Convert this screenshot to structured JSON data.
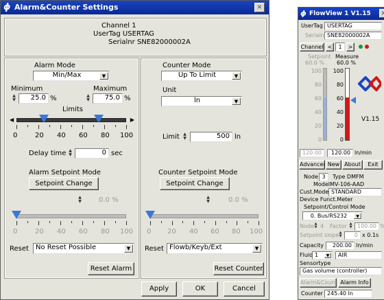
{
  "left": {
    "title": "Alarm&Counter Settings",
    "close": "×",
    "channel_label": "Channel",
    "channel_value": "1",
    "usertag_label": "UserTag",
    "usertag_value": "USERTAG",
    "serial_label": "Serialnr",
    "serial_value": "SNE82000002A",
    "alarm": {
      "mode_label": "Alarm Mode",
      "mode_value": "Min/Max",
      "min_label": "Minimum",
      "min_value": "25.0",
      "min_unit": "%",
      "max_label": "Maximum",
      "max_value": "75.0",
      "max_unit": "%",
      "limits_label": "Limits",
      "scale": [
        "0",
        "20",
        "40",
        "60",
        "80",
        "100"
      ],
      "min_fraction": 0.25,
      "max_fraction": 0.75,
      "delay_label": "Delay time",
      "delay_value": "0",
      "delay_unit": "sec",
      "sp_mode_label": "Alarm Setpoint Mode",
      "sp_button": "Setpoint Change",
      "sp_value": "0.0",
      "sp_unit": "%",
      "reset_label": "Reset",
      "reset_value": "No Reset Possible",
      "reset_button": "Reset Alarm"
    },
    "counter": {
      "mode_label": "Counter Mode",
      "mode_value": "Up To Limit",
      "unit_label": "Unit",
      "unit_value": "ln",
      "limit_label": "Limit",
      "limit_value": "500",
      "limit_unit": "ln",
      "sp_mode_label": "Counter Setpoint Mode",
      "sp_button": "Setpoint Change",
      "sp_value": "0.0",
      "sp_unit": "%",
      "scale": [
        "0",
        "20",
        "40",
        "60",
        "80",
        "100"
      ],
      "reset_label": "Reset",
      "reset_value": "Flowb/Keyb/Ext",
      "reset_button": "Reset Counter"
    },
    "footer": {
      "apply": "Apply",
      "ok": "OK",
      "cancel": "Cancel"
    }
  },
  "right": {
    "title": "FlowView 1  V1.15",
    "close": "×",
    "usertag_label": "UserTag",
    "usertag_value": "USERTAG",
    "serial_label": "Serialnr",
    "serial_value": "SNE82000002A",
    "channel_button": "Channel",
    "channel_prev": "<",
    "channel_value": "1",
    "channel_next": ">",
    "setpoint_label": "Setpoint",
    "measure_label": "Measure",
    "setpoint_value": "60.0",
    "setpoint_unit": "%",
    "measure_value": "60.0",
    "measure_unit": "%",
    "scale": [
      "100",
      "80",
      "60",
      "40",
      "20",
      "0"
    ],
    "setpoint_fraction": 0.6,
    "measure_fraction": 0.6,
    "version_label": "V1.15",
    "flow_setpoint": "120.00",
    "flow_measure": "120.00",
    "flow_unit": "ln/min",
    "tabs": [
      "Advanced",
      "New",
      "About",
      "Exit"
    ],
    "node_label": "Node",
    "node_value": "3",
    "type_label": "Type",
    "type_value": "DMFM",
    "model_label": "Model",
    "model_value": "MV-106-AAD",
    "custmodel_label": "Cust.Model",
    "custmodel_value": "STANDARD",
    "devfunc_label": "Device Funct.",
    "devfunc_value": "Meter",
    "spctrl_label": "Setpoint/Control Mode",
    "spctrl_value": "0. Bus/RS232",
    "node2_label": "Node",
    "node2_value": "4",
    "factor_label": "Factor",
    "factor_value": "100.00",
    "factor_unit": "%",
    "spslope_label": "Setpoint slope",
    "spslope_value": "0",
    "spslope_unit": "x 0.1s",
    "capacity_label": "Capacity",
    "capacity_value": "200.00",
    "capacity_unit": "ln/min",
    "fluid_label": "Fluid",
    "fluid_value": "1",
    "fluid_name": "AIR",
    "sensortype_label": "Sensortype",
    "sensortype_value": "Gas volume (controller)",
    "bottom_tabs": [
      "Alarm&Counter",
      "Alarm Info"
    ],
    "counter_label": "Counter",
    "counter_value": "245.40",
    "counter_unit": "ln"
  }
}
